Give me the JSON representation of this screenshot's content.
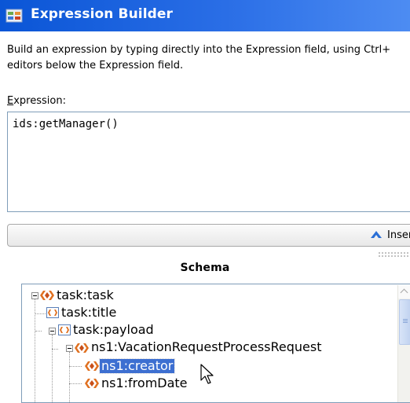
{
  "window": {
    "title": "Expression Builder",
    "icon": "expression-builder-icon"
  },
  "description": {
    "line1": "Build an expression by typing directly into the Expression field, using Ctrl+",
    "line2": "editors below the Expression field."
  },
  "expression": {
    "label_first": "E",
    "label_rest": "xpression:",
    "value": "ids:getManager()"
  },
  "insert": {
    "label": "Insert I",
    "icon": "insert-up-arrow-icon"
  },
  "schema": {
    "title": "Schema",
    "nodes": [
      {
        "label": "task:task",
        "icon": "element-icon",
        "expanded": true
      },
      {
        "label": "task:title",
        "icon": "attribute-icon"
      },
      {
        "label": "task:payload",
        "icon": "attribute-icon",
        "expanded": true
      },
      {
        "label": "ns1:VacationRequestProcessRequest",
        "icon": "element-icon",
        "expanded": true
      },
      {
        "label": "ns1:creator",
        "icon": "element-icon",
        "selected": true
      },
      {
        "label": "ns1:fromDate",
        "icon": "element-icon"
      }
    ]
  },
  "colors": {
    "titlebar": "#0a55d6",
    "selection": "#3d6fd1",
    "element_icon": "#e07020"
  }
}
